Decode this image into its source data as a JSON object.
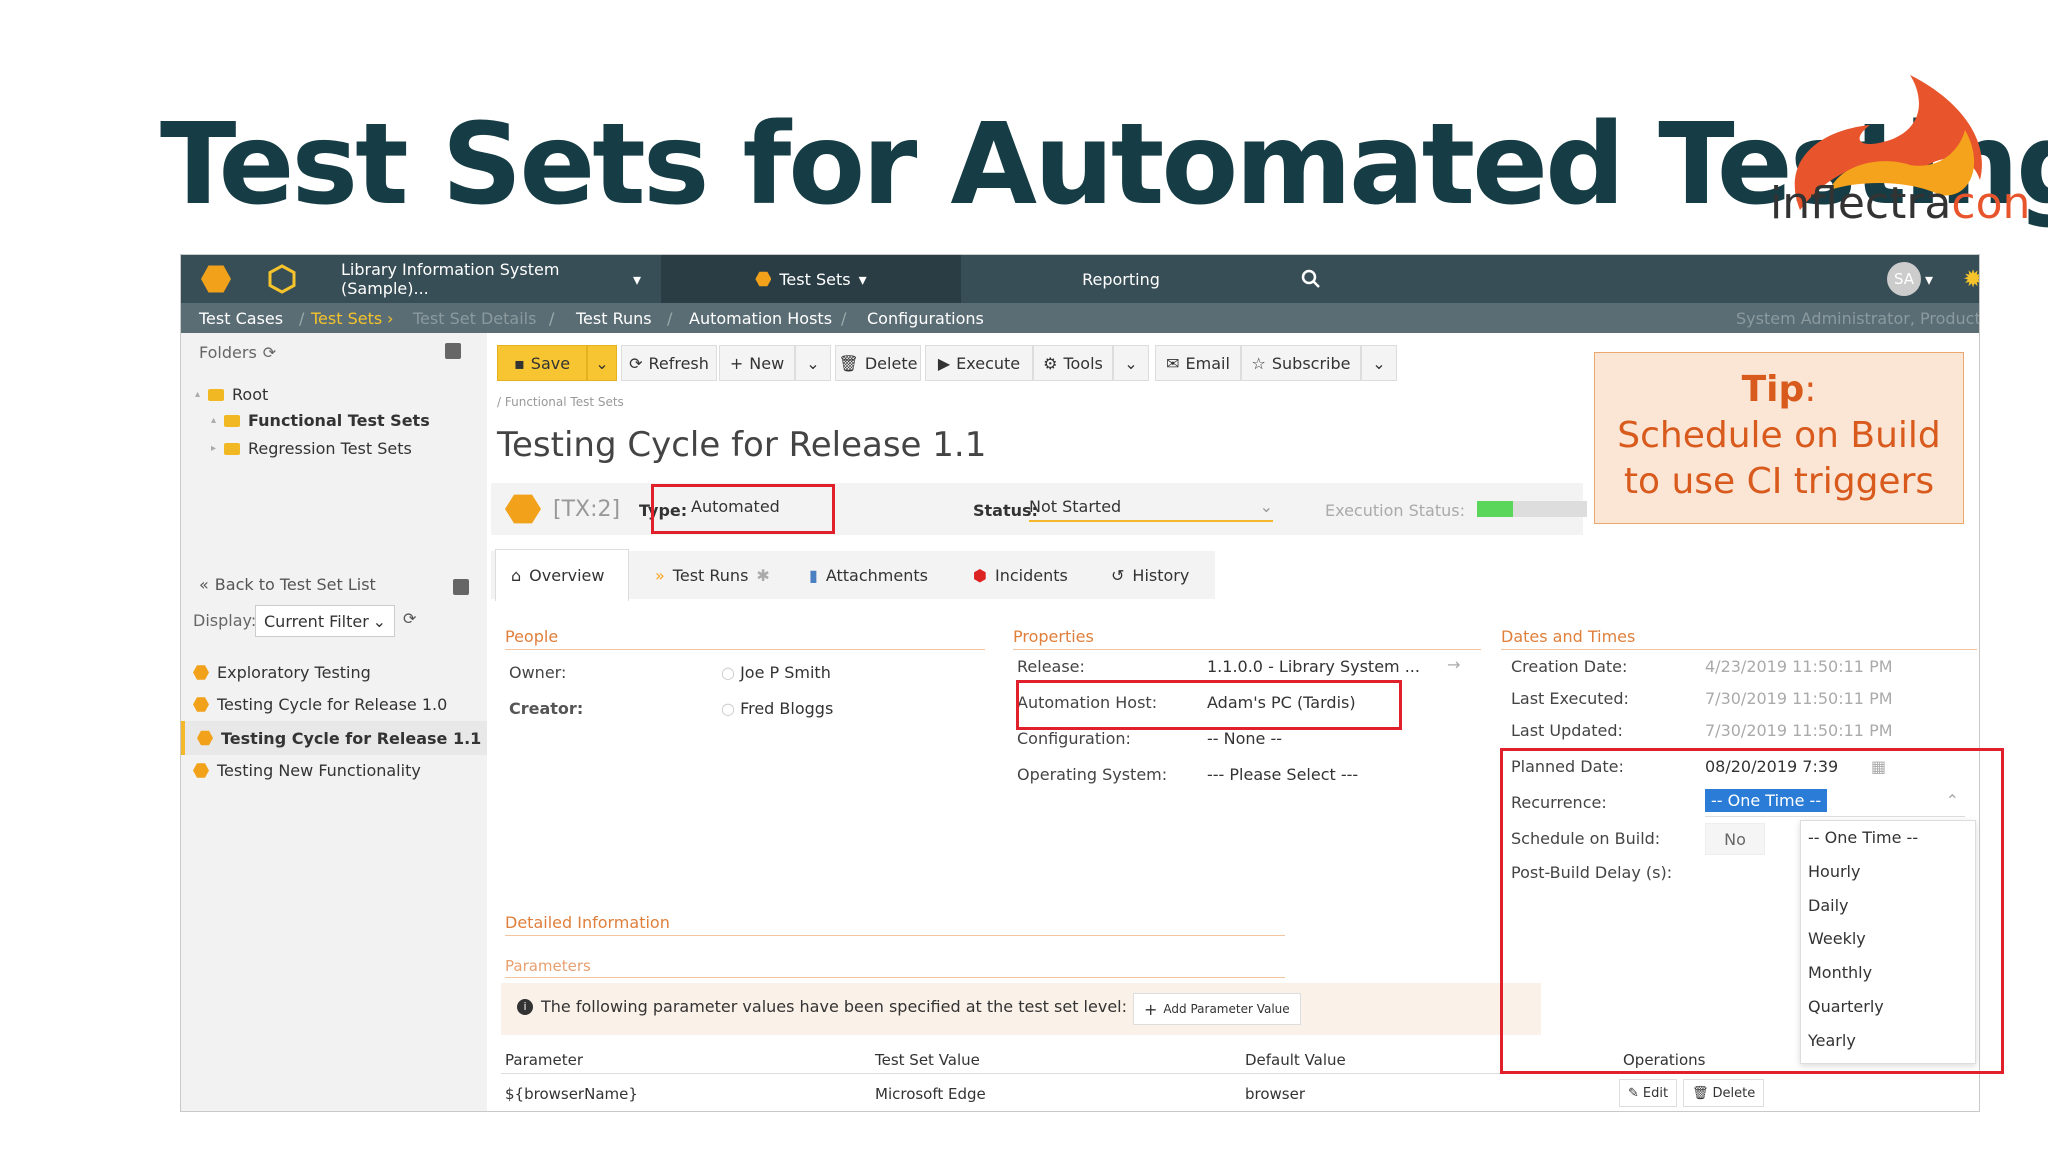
{
  "slide": {
    "title": "Test Sets for Automated Testing",
    "logo_main": "inflectra",
    "logo_accent": "con"
  },
  "nav": {
    "product": "Library Information System (Sample)...",
    "section": "Test Sets",
    "reporting": "Reporting",
    "avatar": "SA"
  },
  "breadcrumbs": [
    "Test Cases",
    "Test Sets",
    "Test Set Details",
    "Test Runs",
    "Automation Hosts",
    "Configurations"
  ],
  "breadcrumb_right": "System Administrator, Product Ow...",
  "sidebar": {
    "folders_label": "Folders",
    "tree": [
      {
        "label": "Root"
      },
      {
        "label": "Functional Test Sets"
      },
      {
        "label": "Regression Test Sets"
      }
    ],
    "back_label": "Back to Test Set List",
    "display_label": "Display:",
    "display_value": "Current Filter",
    "items": [
      {
        "label": "Exploratory Testing"
      },
      {
        "label": "Testing Cycle for Release 1.0"
      },
      {
        "label": "Testing Cycle for Release 1.1"
      },
      {
        "label": "Testing New Functionality"
      }
    ]
  },
  "toolbar": {
    "save": "Save",
    "refresh": "Refresh",
    "new": "New",
    "delete": "Delete",
    "execute": "Execute",
    "tools": "Tools",
    "email": "Email",
    "subscribe": "Subscribe"
  },
  "item": {
    "path": "/ Functional Test Sets",
    "title": "Testing Cycle for Release 1.1",
    "id": "[TX:2]",
    "type_label": "Type:",
    "type_value": "Automated",
    "status_label": "Status:",
    "status_value": "Not Started",
    "exec_status_label": "Execution Status:"
  },
  "tabs": [
    {
      "label": "Overview"
    },
    {
      "label": "Test Runs"
    },
    {
      "label": "Attachments"
    },
    {
      "label": "Incidents"
    },
    {
      "label": "History"
    }
  ],
  "people": {
    "heading": "People",
    "owner_label": "Owner:",
    "owner_value": "Joe P Smith",
    "creator_label": "Creator:",
    "creator_value": "Fred Bloggs"
  },
  "properties": {
    "heading": "Properties",
    "release_label": "Release:",
    "release_value": "1.1.0.0 - Library System ...",
    "host_label": "Automation Host:",
    "host_value": "Adam's PC (Tardis)",
    "config_label": "Configuration:",
    "config_value": "-- None --",
    "os_label": "Operating System:",
    "os_value": "--- Please Select ---"
  },
  "dates": {
    "heading": "Dates and Times",
    "creation_label": "Creation Date:",
    "creation_value": "4/23/2019 11:50:11 PM",
    "executed_label": "Last Executed:",
    "executed_value": "7/30/2019 11:50:11 PM",
    "updated_label": "Last Updated:",
    "updated_value": "7/30/2019 11:50:11 PM",
    "planned_label": "Planned Date:",
    "planned_value": "08/20/2019 7:39",
    "recurrence_label": "Recurrence:",
    "recurrence_value": "-- One Time --",
    "schedule_label": "Schedule on Build:",
    "schedule_value": "No",
    "delay_label": "Post-Build Delay (s):",
    "recurrence_options": [
      "-- One Time --",
      "Hourly",
      "Daily",
      "Weekly",
      "Monthly",
      "Quarterly",
      "Yearly"
    ]
  },
  "detailed": {
    "heading": "Detailed Information",
    "params_heading": "Parameters",
    "info": "The following parameter values have been specified at the test set level:",
    "add_param": "Add Parameter Value"
  },
  "params_table": {
    "headers": [
      "Parameter",
      "Test Set Value",
      "Default Value",
      "Operations"
    ],
    "rows": [
      {
        "parameter": "${browserName}",
        "set_value": "Microsoft Edge",
        "default_value": "browser",
        "edit": "Edit",
        "delete": "Delete"
      }
    ]
  },
  "tip": {
    "title": "Tip",
    "line1": "Schedule on Build",
    "line2": "to use CI triggers"
  }
}
